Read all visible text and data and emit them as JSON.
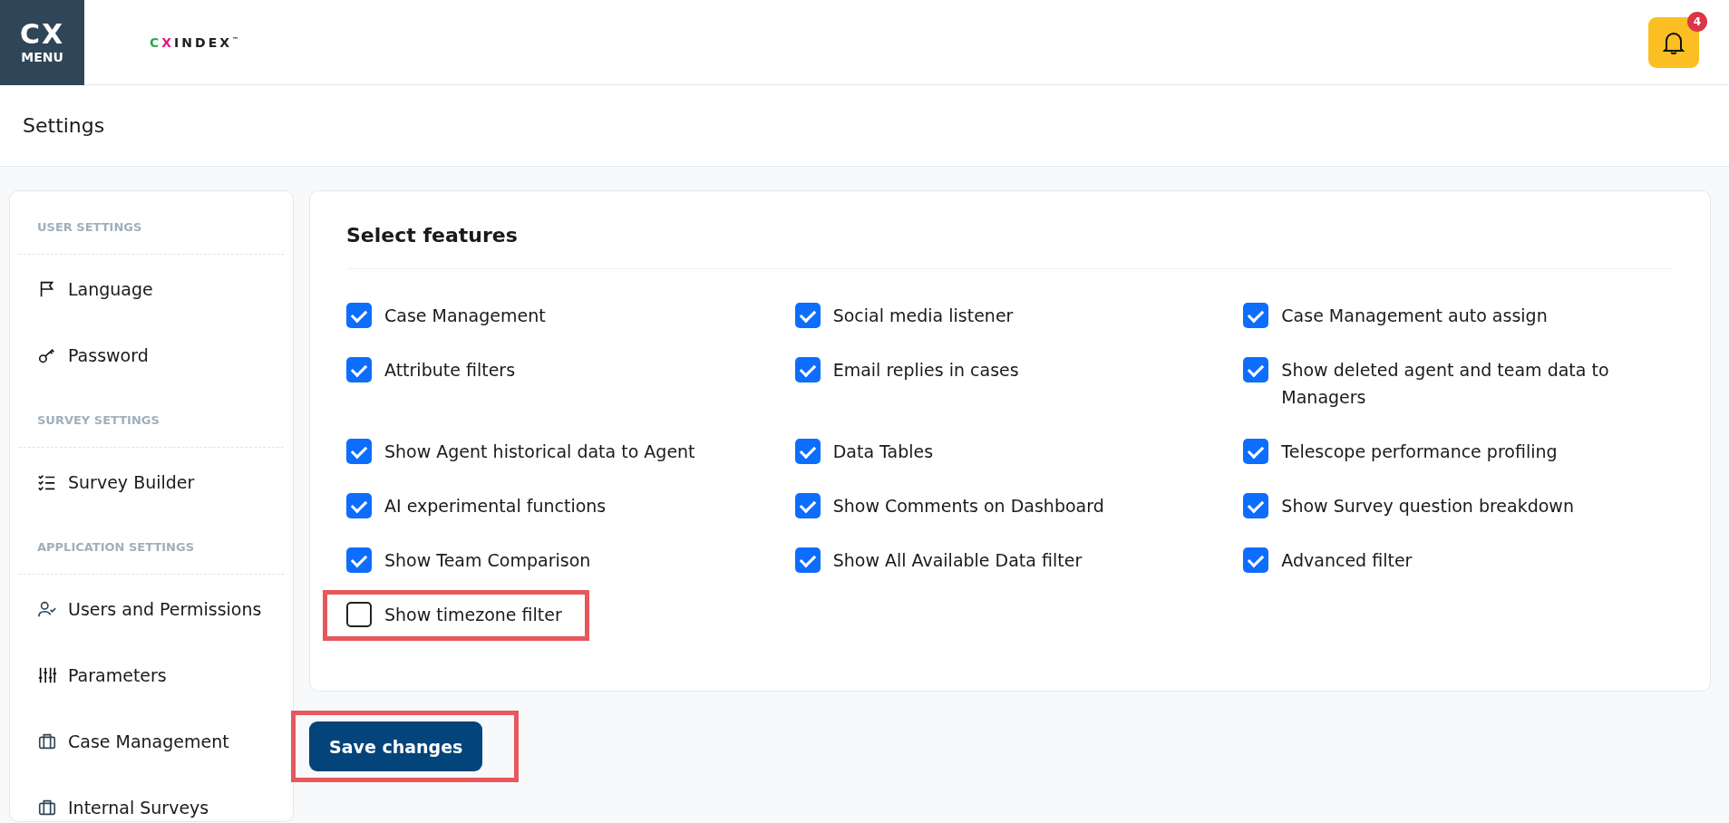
{
  "header": {
    "menu_logo": {
      "mark": "CX",
      "label": "MENU"
    },
    "brand": "CXINDEX",
    "brand_tm": "™",
    "notifications": {
      "count": "4"
    }
  },
  "page_title": "Settings",
  "sidebar": {
    "sections": [
      {
        "heading": "USER SETTINGS",
        "items": [
          {
            "label": "Language"
          },
          {
            "label": "Password"
          }
        ]
      },
      {
        "heading": "SURVEY SETTINGS",
        "items": [
          {
            "label": "Survey Builder"
          }
        ]
      },
      {
        "heading": "APPLICATION SETTINGS",
        "items": [
          {
            "label": "Users and Permissions"
          },
          {
            "label": "Parameters"
          },
          {
            "label": "Case Management"
          },
          {
            "label": "Internal Surveys"
          }
        ]
      }
    ]
  },
  "features": {
    "title": "Select features",
    "items": [
      {
        "label": "Case Management",
        "checked": true,
        "highlighted": false
      },
      {
        "label": "Social media listener",
        "checked": true,
        "highlighted": false
      },
      {
        "label": "Case Management auto assign",
        "checked": true,
        "highlighted": false
      },
      {
        "label": "Attribute filters",
        "checked": true,
        "highlighted": false
      },
      {
        "label": "Email replies in cases",
        "checked": true,
        "highlighted": false
      },
      {
        "label": "Show deleted agent and team data to Managers",
        "checked": true,
        "highlighted": false
      },
      {
        "label": "Show Agent historical data to Agent",
        "checked": true,
        "highlighted": false
      },
      {
        "label": "Data Tables",
        "checked": true,
        "highlighted": false
      },
      {
        "label": "Telescope performance profiling",
        "checked": true,
        "highlighted": false
      },
      {
        "label": "AI experimental functions",
        "checked": true,
        "highlighted": false
      },
      {
        "label": "Show Comments on Dashboard",
        "checked": true,
        "highlighted": false
      },
      {
        "label": "Show Survey question breakdown",
        "checked": true,
        "highlighted": false
      },
      {
        "label": "Show Team Comparison",
        "checked": true,
        "highlighted": false
      },
      {
        "label": "Show All Available Data filter",
        "checked": true,
        "highlighted": false
      },
      {
        "label": "Advanced filter",
        "checked": true,
        "highlighted": false
      },
      {
        "label": "Show timezone filter",
        "checked": false,
        "highlighted": true
      }
    ]
  },
  "save_button": {
    "label": "Save changes",
    "highlighted": true
  }
}
